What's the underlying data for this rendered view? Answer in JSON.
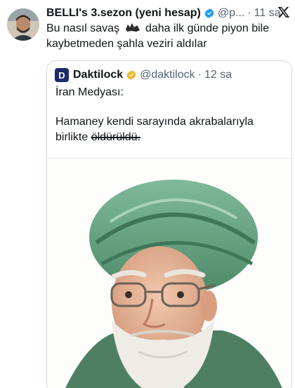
{
  "tweet": {
    "display_name": "BELLI's 3.sezon (yeni hesap)",
    "handle": "@p...",
    "separator": "·",
    "time": "11 sa",
    "text_line1_a": "Bu nasıl savaş",
    "text_line1_b": "daha ilk günde piyon bile",
    "text_line2": "kaybetmeden şahla veziri aldılar"
  },
  "quote": {
    "avatar_letter": "D",
    "display_name": "Daktilock",
    "handle": "@daktilock",
    "separator": "·",
    "time": "12 sa",
    "line1": "İran Medyası:",
    "line2": "Hamaney kendi sarayında akrabalarıyla",
    "line3_a": "birlikte",
    "line3_struck": "öldürüldü."
  },
  "colors": {
    "verified_blue": "#1d9bf0",
    "verified_gold": "#e8b829",
    "turban_green": "#5f9c7a",
    "muted_text": "#536471"
  },
  "icons": {
    "verified": "verified-badge-icon",
    "x_logo": "x-logo-icon",
    "redacted_emoji": "redacted-emoji-icon"
  }
}
